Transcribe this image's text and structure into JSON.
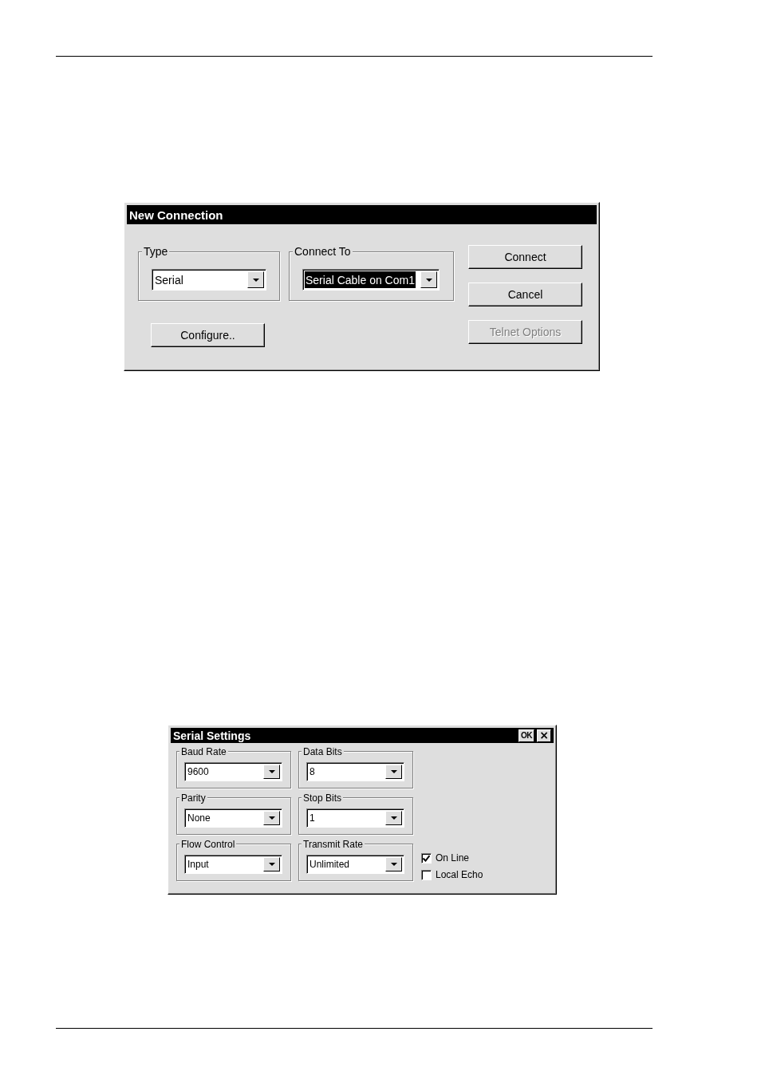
{
  "dialogs": [
    {
      "title": "New Connection",
      "groups": [
        {
          "label": "Type",
          "value": "Serial",
          "highlighted": false
        },
        {
          "label": "Connect To",
          "value": "Serial Cable on Com1",
          "highlighted": true
        }
      ],
      "buttons": [
        {
          "label": "Connect",
          "disabled": false
        },
        {
          "label": "Cancel",
          "disabled": false
        },
        {
          "label": "Telnet Options",
          "disabled": true
        }
      ],
      "extra_buttons": [
        {
          "label": "Configure..",
          "disabled": false
        }
      ]
    },
    {
      "title": "Serial Settings",
      "title_buttons": [
        {
          "kind": "ok",
          "label": "OK"
        },
        {
          "kind": "close",
          "label": "×"
        }
      ],
      "groups": [
        {
          "label": "Baud Rate",
          "value": "9600",
          "highlighted": false
        },
        {
          "label": "Data Bits",
          "value": "8",
          "highlighted": false
        },
        {
          "label": "Parity",
          "value": "None",
          "highlighted": false
        },
        {
          "label": "Stop Bits",
          "value": "1",
          "highlighted": false
        },
        {
          "label": "Flow Control",
          "value": "Input",
          "highlighted": false
        },
        {
          "label": "Transmit Rate",
          "value": "Unlimited",
          "highlighted": false
        }
      ],
      "checkboxes": [
        {
          "label": "On Line",
          "checked": true
        },
        {
          "label": "Local Echo",
          "checked": false
        }
      ]
    }
  ]
}
